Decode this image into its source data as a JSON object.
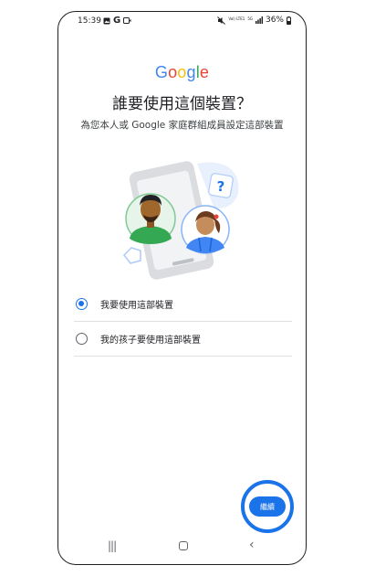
{
  "status": {
    "time": "15:39",
    "left_icons": [
      "image-icon",
      "google-g-icon",
      "video-icon"
    ],
    "right": {
      "volte": "Vol) LTE1",
      "network": "5G",
      "battery": "36%"
    }
  },
  "google_logo": {
    "text": "Google",
    "colors": [
      "#4285F4",
      "#EA4335",
      "#FBBC05",
      "#4285F4",
      "#34A853",
      "#EA4335"
    ]
  },
  "title": "誰要使用這個裝置？",
  "subtitle": "為您本人或 Google 家庭群組成員設定這部裝置",
  "options": [
    {
      "label": "我要使用這部裝置",
      "selected": true
    },
    {
      "label": "我的孩子要使用這部裝置",
      "selected": false
    }
  ],
  "continue_label": "繼續",
  "accent_color": "#1a73e8",
  "nav": {
    "recents": "|||",
    "home": "home-icon",
    "back": "‹"
  }
}
